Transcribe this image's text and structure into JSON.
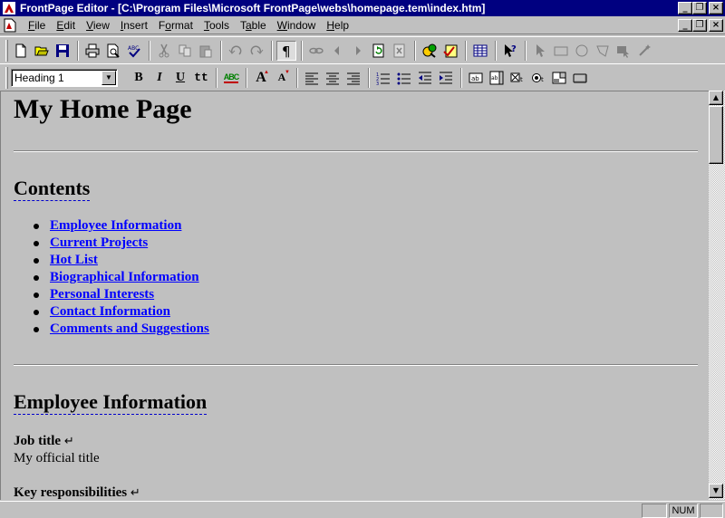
{
  "window": {
    "title": "FrontPage Editor - [C:\\Program Files\\Microsoft FrontPage\\webs\\homepage.tem\\index.htm]",
    "controls": [
      "_",
      "❐",
      "×"
    ]
  },
  "menu": [
    {
      "pre": "",
      "u": "F",
      "post": "ile"
    },
    {
      "pre": "",
      "u": "E",
      "post": "dit"
    },
    {
      "pre": "",
      "u": "V",
      "post": "iew"
    },
    {
      "pre": "",
      "u": "I",
      "post": "nsert"
    },
    {
      "pre": "F",
      "u": "o",
      "post": "rmat"
    },
    {
      "pre": "",
      "u": "T",
      "post": "ools"
    },
    {
      "pre": "T",
      "u": "a",
      "post": "ble"
    },
    {
      "pre": "",
      "u": "W",
      "post": "indow"
    },
    {
      "pre": "",
      "u": "H",
      "post": "elp"
    }
  ],
  "format_toolbar": {
    "style_value": "Heading 1",
    "bold_label": "B",
    "italic_label": "I",
    "underline_label": "U",
    "typewriter_label": "tt",
    "color_label": "ABC",
    "font_up_label": "A",
    "font_down_label": "A"
  },
  "document": {
    "title": "My Home Page",
    "contents_heading": "Contents",
    "links": [
      "Employee Information",
      "Current Projects",
      "Hot List",
      "Biographical Information",
      "Personal Interests",
      "Contact Information",
      "Comments and Suggestions"
    ],
    "section_heading": "Employee Information",
    "job_title_label": "Job title",
    "job_title_value": "My official title",
    "key_resp_label": "Key responsibilities",
    "return_glyph": "↵"
  },
  "status": {
    "num_indicator": "NUM"
  }
}
